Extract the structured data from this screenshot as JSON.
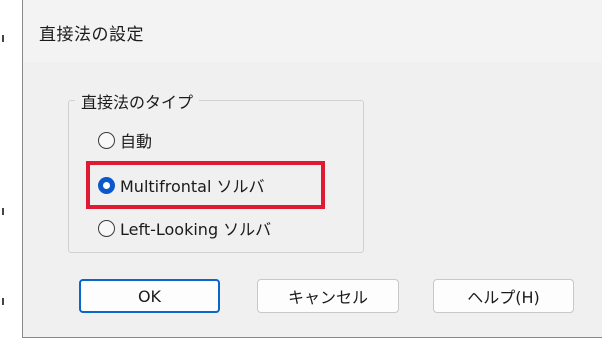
{
  "dialog": {
    "title": "直接法の設定"
  },
  "group": {
    "legend": "直接法のタイプ",
    "options": [
      {
        "label": "自動",
        "selected": false
      },
      {
        "label": "Multifrontal ソルバ",
        "selected": true
      },
      {
        "label": "Left-Looking ソルバ",
        "selected": false
      }
    ]
  },
  "buttons": {
    "ok": "OK",
    "cancel": "キャンセル",
    "help": "ヘルプ(H)"
  },
  "colors": {
    "accent": "#0a58ca",
    "highlight": "#e01a32"
  },
  "icons": {
    "close": "close-icon"
  }
}
